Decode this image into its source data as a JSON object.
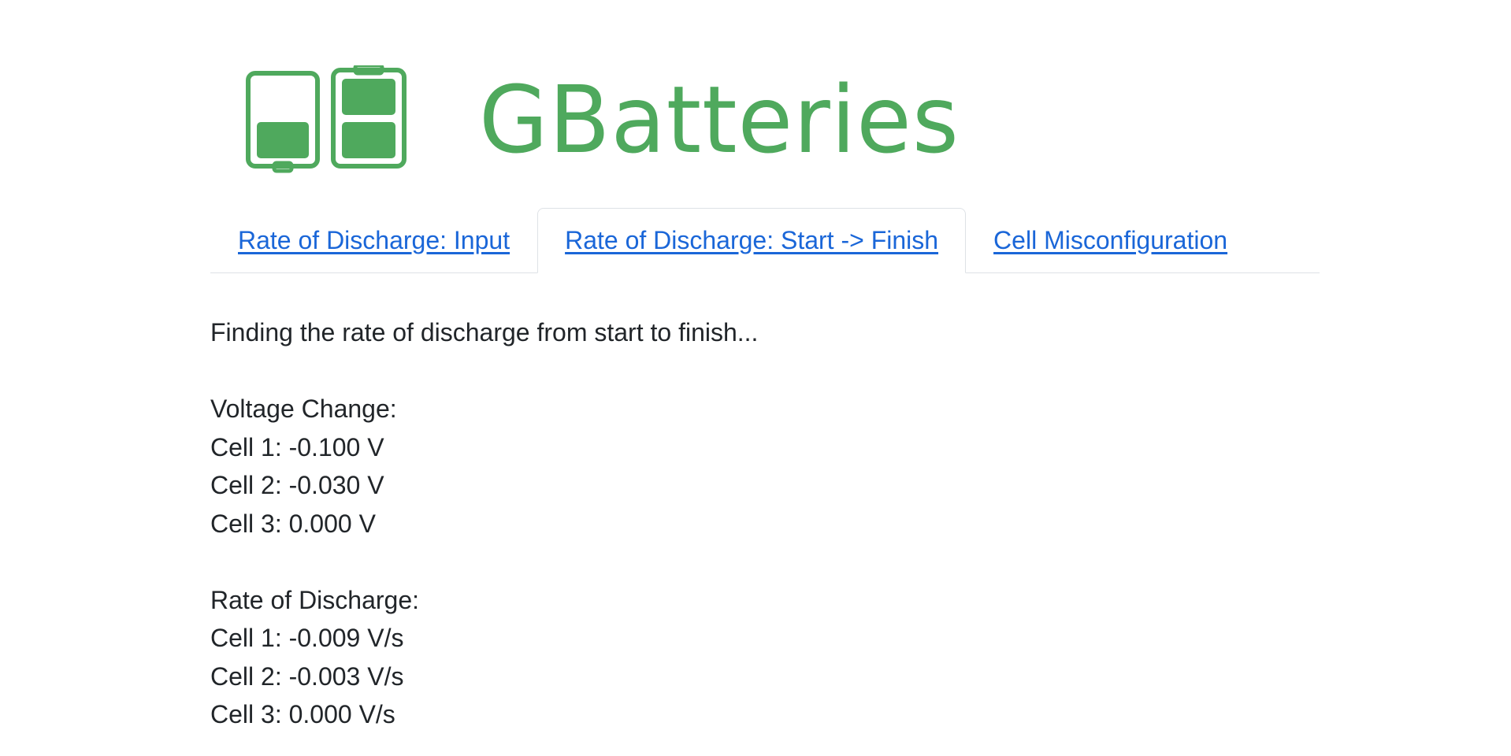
{
  "brand": {
    "name": "GBatteries",
    "logo_icon": "battery-cells-logo-icon",
    "color": "#4fa95d"
  },
  "tabs": [
    {
      "label": "Rate of Discharge: Input",
      "active": false
    },
    {
      "label": "Rate of Discharge: Start -> Finish",
      "active": true
    },
    {
      "label": "Cell Misconfiguration",
      "active": false
    }
  ],
  "content": {
    "intro": "Finding the rate of discharge from start to finish...",
    "voltage_change": {
      "heading": "Voltage Change:",
      "cells": [
        "Cell 1: -0.100 V",
        "Cell 2: -0.030 V",
        "Cell 3: 0.000 V"
      ]
    },
    "rate_of_discharge": {
      "heading": "Rate of Discharge:",
      "cells": [
        "Cell 1: -0.009 V/s",
        "Cell 2: -0.003 V/s",
        "Cell 3: 0.000 V/s"
      ]
    }
  },
  "colors": {
    "link": "#1a66d8",
    "text": "#212529",
    "border": "#dee2e6"
  }
}
